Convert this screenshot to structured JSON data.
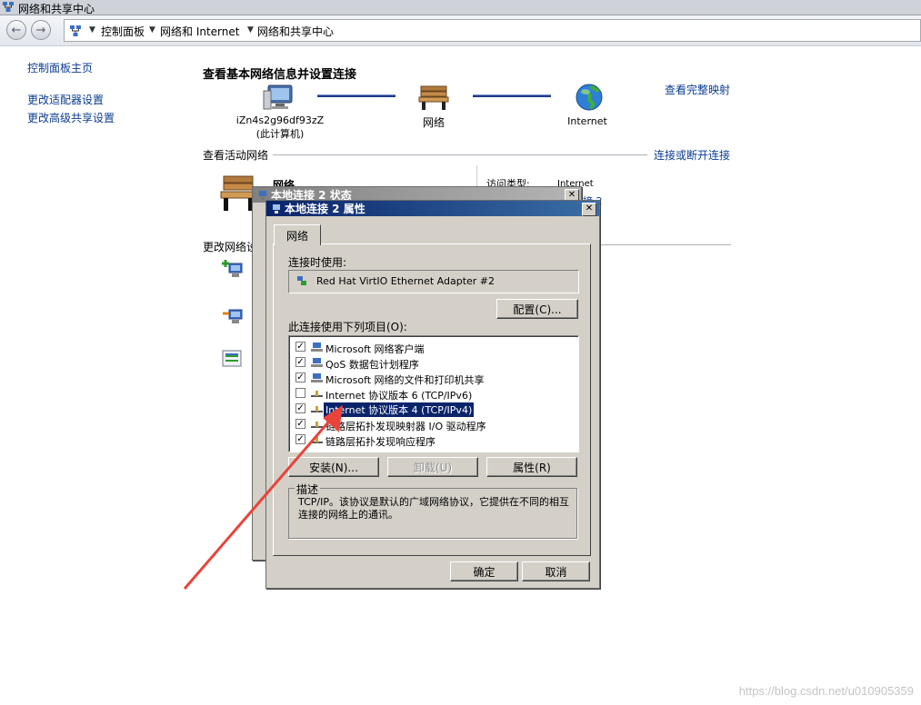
{
  "window": {
    "title": "网络和共享中心"
  },
  "address": {
    "crumbs": [
      "控制面板",
      "网络和 Internet",
      "网络和共享中心"
    ]
  },
  "left_nav": {
    "items": [
      "控制面板主页",
      "更改适配器设置",
      "更改高级共享设置"
    ]
  },
  "main": {
    "heading": "查看基本网络信息并设置连接",
    "view_full_map": "查看完整映射",
    "map": {
      "computer_name": "iZn4s2g96df93zZ",
      "computer_sub": "(此计算机)",
      "network": "网络",
      "internet": "Internet"
    },
    "active_networks": "查看活动网络",
    "connect_disconnect": "连接或断开连接",
    "network_name_partial": "网络",
    "access_type_label": "访问类型:",
    "access_type_value": "Internet",
    "connection_partial": "接 2",
    "change_settings_partial": "更改网络设"
  },
  "status_dialog": {
    "title": "本地连接 2 状态"
  },
  "prop_dialog": {
    "title": "本地连接 2 属性",
    "tab": "网络",
    "connect_using_label": "连接时使用:",
    "adapter": "Red Hat VirtIO Ethernet Adapter #2",
    "configure_button": "配置(C)...",
    "items_label": "此连接使用下列项目(O):",
    "items": [
      {
        "label": "Microsoft 网络客户端",
        "checked": true,
        "icon": "network-client-icon"
      },
      {
        "label": "QoS 数据包计划程序",
        "checked": true,
        "icon": "qos-icon"
      },
      {
        "label": "Microsoft 网络的文件和打印机共享",
        "checked": true,
        "icon": "file-share-icon"
      },
      {
        "label": "Internet 协议版本 6 (TCP/IPv6)",
        "checked": false,
        "icon": "protocol-icon"
      },
      {
        "label": "Internet 协议版本 4 (TCP/IPv4)",
        "checked": true,
        "icon": "protocol-icon",
        "selected": true
      },
      {
        "label": "链路层拓扑发现映射器 I/O 驱动程序",
        "checked": true,
        "icon": "protocol-icon"
      },
      {
        "label": "链路层拓扑发现响应程序",
        "checked": true,
        "icon": "protocol-icon"
      }
    ],
    "install_button": "安装(N)...",
    "uninstall_button": "卸载(U)",
    "properties_button": "属性(R)",
    "description_label": "描述",
    "description_text": "TCP/IP。该协议是默认的广域网络协议，它提供在不同的相互连接的网络上的通讯。",
    "ok_button": "确定",
    "cancel_button": "取消"
  },
  "watermark": "https://blog.csdn.net/u010905359",
  "colors": {
    "annotation_arrow": "#e8443a",
    "selection": "#0a246a",
    "link": "#0b3d91"
  }
}
